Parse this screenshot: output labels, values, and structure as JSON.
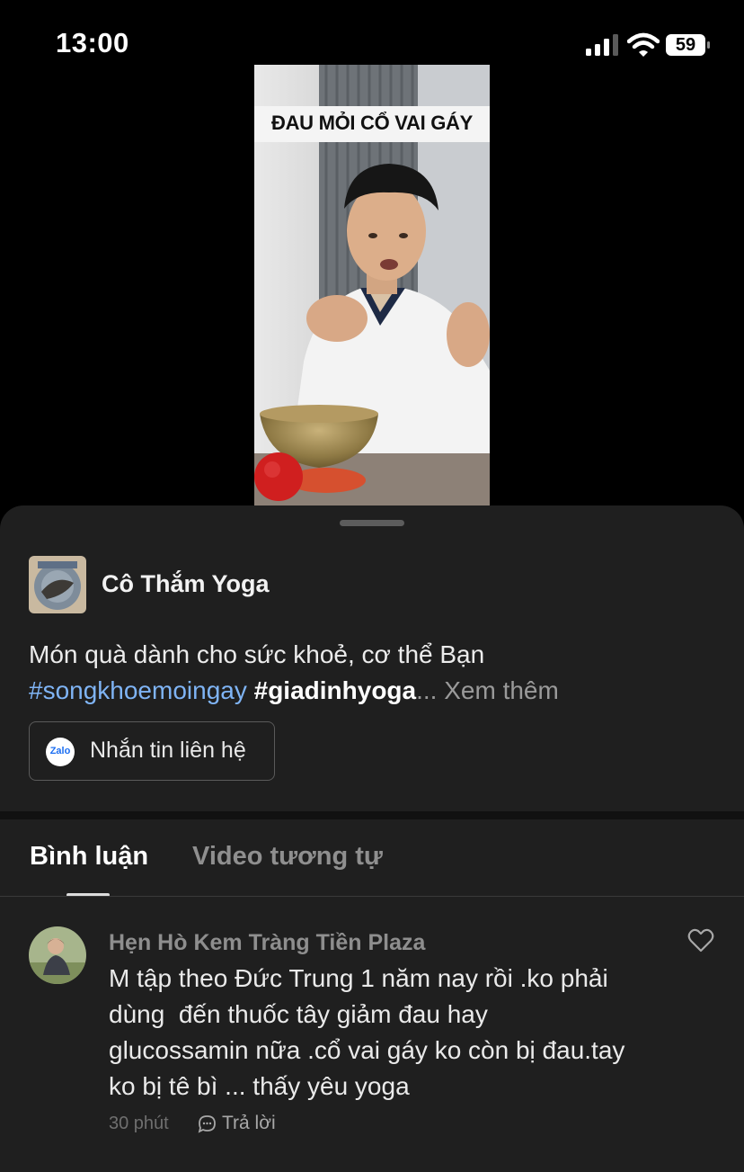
{
  "status_bar": {
    "time": "13:00",
    "battery_level": "59"
  },
  "video": {
    "caption": "ĐAU MỎI CỔ VAI GÁY"
  },
  "channel": {
    "name": "Cô Thắm Yoga"
  },
  "description": {
    "text": "Món quà dành cho sức khoẻ, cơ thể Bạn",
    "hashtag1": "#songkhoemoingay",
    "hashtag2": "#giadinhyoga",
    "see_more": "... Xem thêm"
  },
  "contact_button": {
    "icon_label": "Zalo",
    "label": "Nhắn tin liên hệ"
  },
  "tabs": [
    {
      "label": "Bình luận",
      "active": true
    },
    {
      "label": "Video tương tự",
      "active": false
    }
  ],
  "comments": [
    {
      "author": "Hẹn Hò Kem Tràng Tiền Plaza",
      "text": "M tập theo Đức Trung 1 năm nay rồi .ko phải\ndùng  đến thuốc tây giảm đau hay\nglucossamin nữa .cổ vai gáy ko còn bị đau.tay\nko bị tê bì ... thấy yêu yoga",
      "time": "30 phút",
      "reply_label": "Trả lời"
    }
  ],
  "icons": {
    "signal": "signal-icon",
    "wifi": "wifi-icon",
    "battery": "battery-icon",
    "zalo": "zalo-icon",
    "like": "heart-icon",
    "reply": "chat-bubble-icon"
  },
  "colors": {
    "background": "#000000",
    "sheet": "#1f1f1f",
    "hashtag": "#7fb4f5",
    "muted": "#8e8e8e"
  }
}
